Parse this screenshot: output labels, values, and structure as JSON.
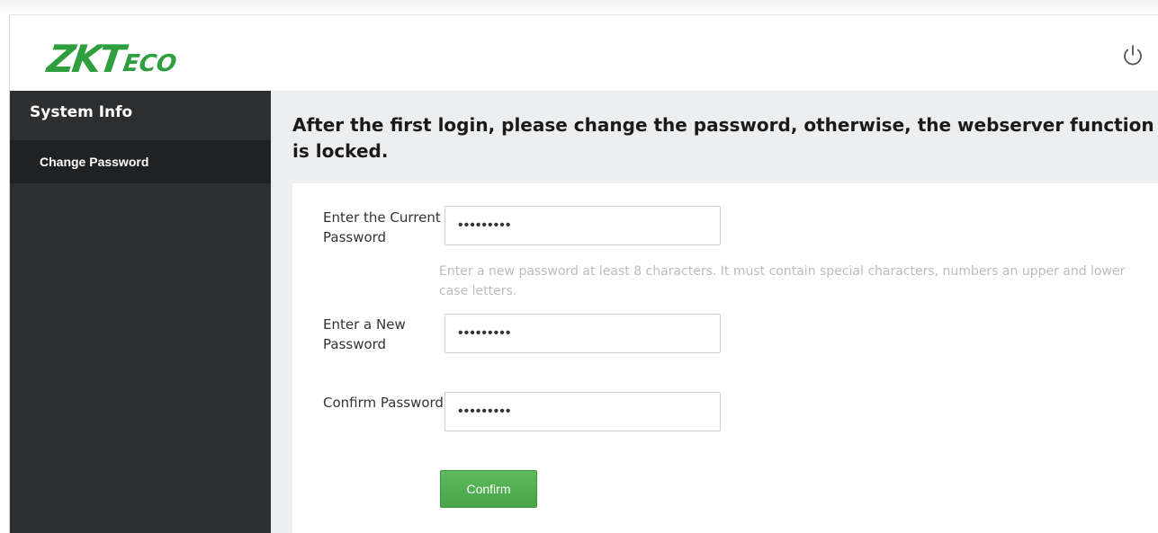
{
  "header": {
    "logo_main": "ZKT",
    "logo_sub": "ECO",
    "power_icon": "power-icon"
  },
  "sidebar": {
    "section_title": "System Info",
    "items": [
      {
        "label": "Change Password",
        "active": true
      }
    ]
  },
  "main": {
    "notice": "After the first login, please change the password, otherwise, the webserver function is locked.",
    "form": {
      "current_password_label": "Enter the Current Password",
      "current_password_value": "•••••••••",
      "hint": "Enter a new password at least 8 characters. It must contain special characters, numbers an upper and lower case letters.",
      "new_password_label": "Enter a New Password",
      "new_password_value": "•••••••••",
      "confirm_password_label": "Confirm Password",
      "confirm_password_value": "•••••••••",
      "confirm_button": "Confirm"
    }
  },
  "colors": {
    "brand_green": "#2e9e3e",
    "sidebar_bg": "#2c2e30",
    "sidebar_active_bg": "#1f2123",
    "main_bg": "#edeeef",
    "button_green": "#4cae4c",
    "hint_text": "#bcbcbc"
  }
}
